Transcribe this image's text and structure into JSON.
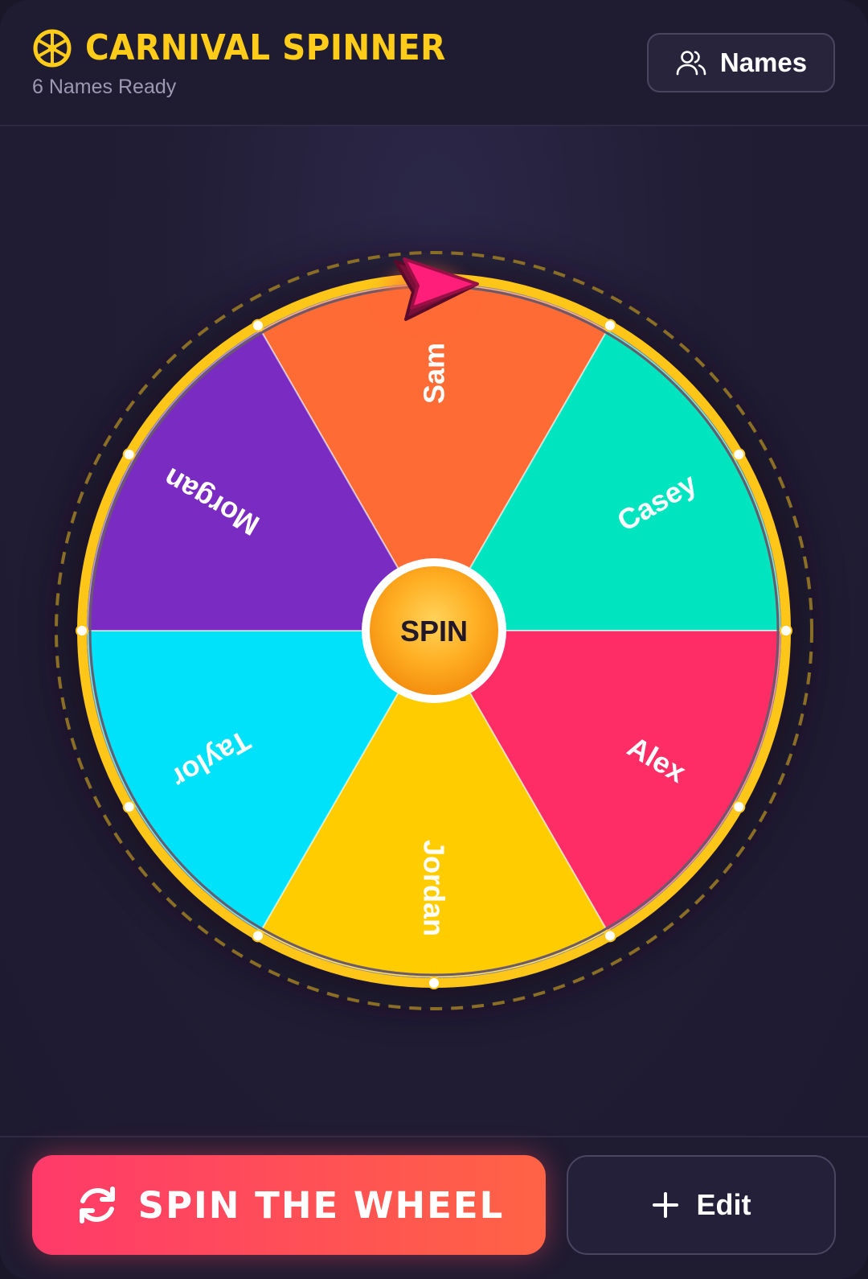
{
  "header": {
    "title": "CARNIVAL SPINNER",
    "subtitle": "6 Names Ready",
    "names_button": "Names",
    "brand_icon": "wheel-icon",
    "names_icon": "users-icon"
  },
  "wheel": {
    "center_label": "SPIN",
    "segments": [
      {
        "name": "Sam",
        "color": "#ff6b35"
      },
      {
        "name": "Casey",
        "color": "#00e5c0"
      },
      {
        "name": "Alex",
        "color": "#ff2d66"
      },
      {
        "name": "Jordan",
        "color": "#ffcc00"
      },
      {
        "name": "Taylor",
        "color": "#00e1fa"
      },
      {
        "name": "Morgan",
        "color": "#7a2bc1"
      }
    ],
    "rim_color": "#ffc61a",
    "pointer_color": "#ff1f7a",
    "pointer_icon": "pointer-arrow-icon"
  },
  "footer": {
    "spin_button": "SPIN THE WHEEL",
    "spin_icon": "refresh-icon",
    "edit_button": "Edit",
    "edit_icon": "plus-icon"
  },
  "colors": {
    "accent": "#ffcc1a",
    "background": "#1f1b31",
    "spin_gradient_start": "#ff3a6a",
    "spin_gradient_end": "#ff6345"
  }
}
